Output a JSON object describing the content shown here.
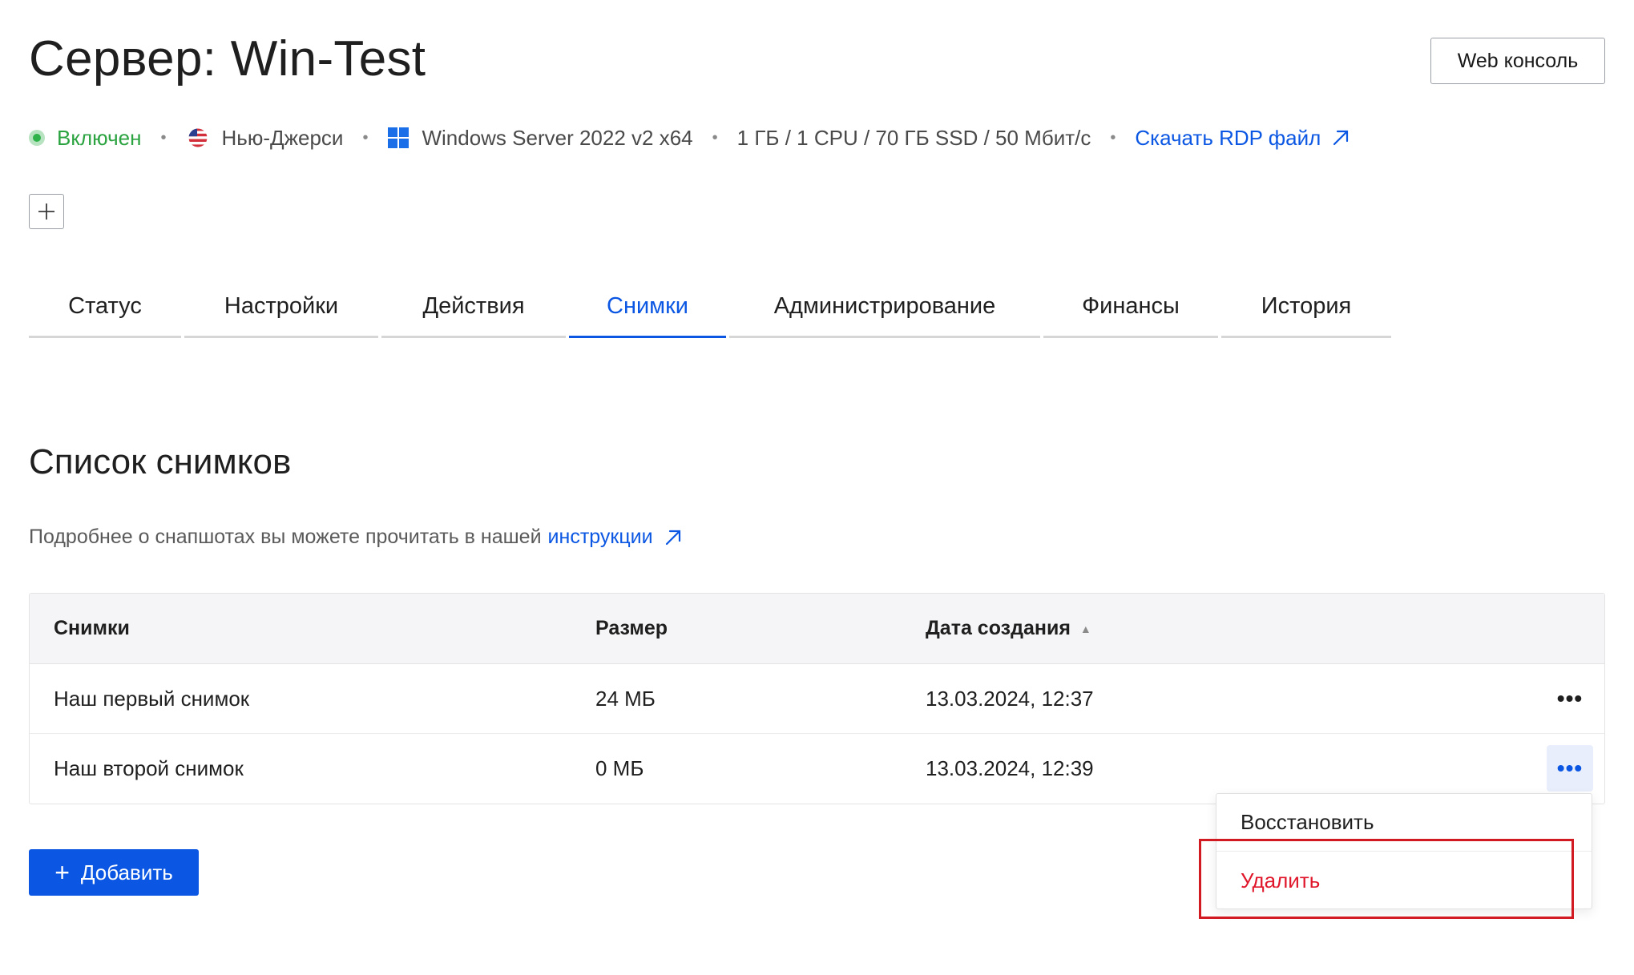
{
  "header": {
    "title": "Сервер: Win-Test",
    "web_console_label": "Web консоль"
  },
  "info": {
    "status": "Включен",
    "location": "Нью-Джерси",
    "os": "Windows Server 2022 v2 x64",
    "specs": "1 ГБ / 1 CPU / 70 ГБ SSD / 50 Мбит/с",
    "rdp_link": "Скачать RDP файл",
    "status_color": "#2ba340",
    "link_color": "#0b57e3"
  },
  "tabs": [
    {
      "label": "Статус",
      "width": 190
    },
    {
      "label": "Настройки",
      "width": 242
    },
    {
      "label": "Действия",
      "width": 230
    },
    {
      "label": "Снимки",
      "width": 196,
      "active": true
    },
    {
      "label": "Администрирование",
      "width": 388
    },
    {
      "label": "Финансы",
      "width": 218
    },
    {
      "label": "История",
      "width": 212
    }
  ],
  "section": {
    "title": "Список снимков",
    "desc": "Подробнее о снапшотах вы можете прочитать в нашей",
    "desc_link": "инструкции"
  },
  "table": {
    "headers": {
      "name": "Снимки",
      "size": "Размер",
      "date": "Дата создания"
    },
    "rows": [
      {
        "name": "Наш первый снимок",
        "size": "24 МБ",
        "date": "13.03.2024, 12:37"
      },
      {
        "name": "Наш второй снимок",
        "size": "0 МБ",
        "date": "13.03.2024, 12:39"
      }
    ]
  },
  "add_button": "Добавить",
  "menu": {
    "restore": "Восстановить",
    "delete": "Удалить",
    "delete_color": "#e0172b"
  }
}
